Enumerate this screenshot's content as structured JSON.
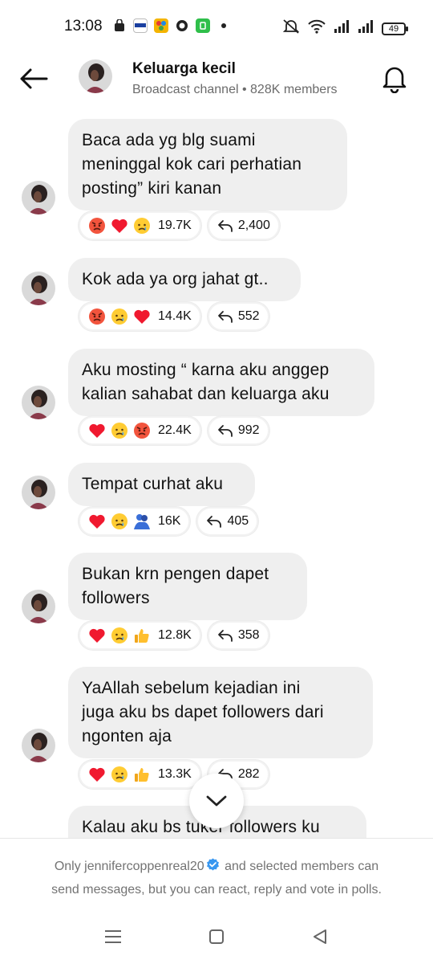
{
  "status_bar": {
    "time": "13:08",
    "battery": "49",
    "app_icons": [
      "shopping-bag-icon",
      "btn-bank-icon",
      "photos-icon",
      "circle-app-icon",
      "green-app-icon"
    ]
  },
  "header": {
    "title": "Keluarga kecil",
    "subtitle": "Broadcast channel • 828K members"
  },
  "messages": [
    {
      "text_lines": [
        "Baca ada yg blg suami",
        "meninggal kok cari perhatian",
        "posting” kiri kanan"
      ],
      "reactions": [
        "angry",
        "heart",
        "cry"
      ],
      "reaction_count": "19.7K",
      "reply_count": "2,400"
    },
    {
      "text_lines": [
        "Kok ada ya org jahat gt.."
      ],
      "reactions": [
        "angry",
        "cry",
        "heart"
      ],
      "reaction_count": "14.4K",
      "reply_count": "552"
    },
    {
      "text_lines": [
        "Aku mosting “ karna aku anggep",
        "kalian sahabat dan keluarga aku"
      ],
      "reactions": [
        "heart",
        "cry",
        "angry"
      ],
      "reaction_count": "22.4K",
      "reply_count": "992"
    },
    {
      "text_lines": [
        "Tempat curhat aku"
      ],
      "reactions": [
        "heart",
        "cry",
        "hug"
      ],
      "reaction_count": "16K",
      "reply_count": "405"
    },
    {
      "text_lines": [
        "Bukan krn pengen dapet",
        "followers"
      ],
      "reactions": [
        "heart",
        "cry",
        "thumbs"
      ],
      "reaction_count": "12.8K",
      "reply_count": "358"
    },
    {
      "text_lines": [
        "YaAllah sebelum kejadian ini",
        "juga aku bs dapet followers dari",
        "ngonten aja"
      ],
      "reactions": [
        "heart",
        "cry",
        "thumbs"
      ],
      "reaction_count": "13.3K",
      "reply_count": "282"
    },
    {
      "text_lines": [
        "Kalau aku bs tuker followers ku"
      ]
    }
  ],
  "footer": {
    "line1_prefix": "Only ",
    "username": "jennifercoppenreal20",
    "line1_suffix": " and selected members can",
    "line2": "send messages, but you can react, reply and vote in polls."
  },
  "colors": {
    "bubble": "#efefef",
    "verified": "#3897f0",
    "muted_text": "#6b6b6b"
  }
}
